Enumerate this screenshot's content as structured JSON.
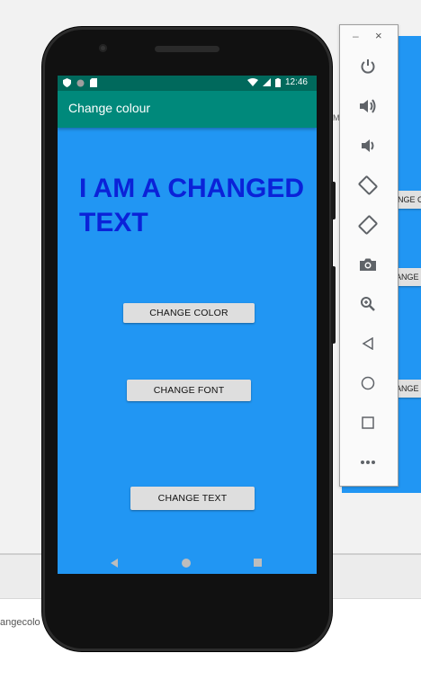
{
  "app": {
    "title": "Change colour",
    "changed_text": "I AM A CHANGED TEXT",
    "buttons": {
      "change_color": "CHANGE COLOR",
      "change_font": "CHANGE FONT",
      "change_text": "CHANGE TEXT"
    },
    "status": {
      "time": "12:46"
    }
  },
  "background": {
    "desktop_text": "angecolo",
    "fragment_m": "M",
    "fragments": [
      "NGE CO",
      "ANGE FO",
      "ANGE T"
    ]
  },
  "toolbar": {
    "minimize": "–",
    "close": "×",
    "icons": [
      "power-icon",
      "volume-up-icon",
      "volume-down-icon",
      "rotate-left-icon",
      "rotate-right-icon",
      "camera-icon",
      "zoom-icon",
      "back-icon",
      "home-icon",
      "overview-icon",
      "more-icon"
    ]
  },
  "colors": {
    "screen": "#2196f3",
    "appbar": "#00897b",
    "statusbar": "#00695c",
    "changed_text": "#0b22d8"
  }
}
